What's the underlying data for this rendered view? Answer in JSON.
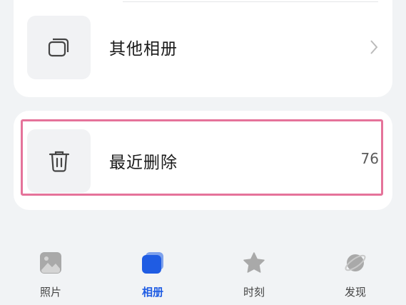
{
  "albums": {
    "other_label": "其他相册",
    "trash_label": "最近删除",
    "trash_count": "76"
  },
  "tabbar": {
    "photos": "照片",
    "albums": "相册",
    "moments": "时刻",
    "discover": "发现",
    "active_color": "#1f5ce3"
  },
  "highlight_color": "#e5739a"
}
